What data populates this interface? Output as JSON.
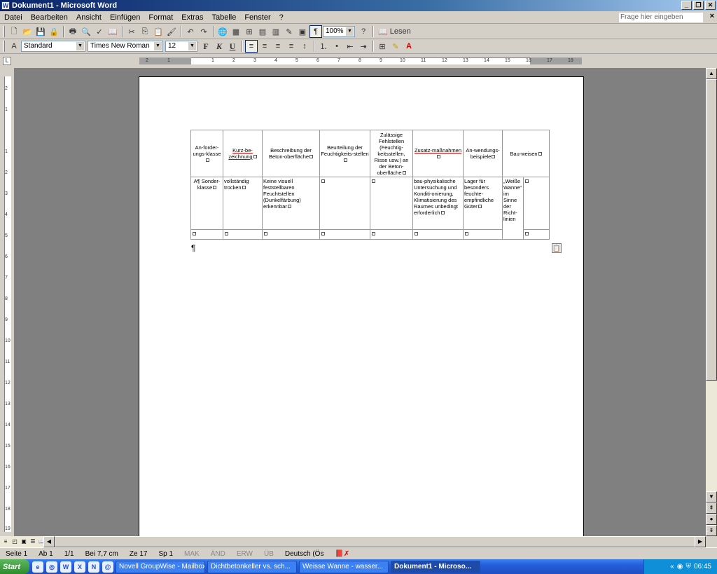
{
  "window": {
    "title": "Dokument1 - Microsoft Word"
  },
  "menu": [
    "Datei",
    "Bearbeiten",
    "Ansicht",
    "Einfügen",
    "Format",
    "Extras",
    "Tabelle",
    "Fenster",
    "?"
  ],
  "help": {
    "placeholder": "Frage hier eingeben"
  },
  "toolbar": {
    "zoom": "100%",
    "read_label": "Lesen",
    "style": "Standard",
    "font": "Times New Roman",
    "size": "12",
    "bold": "F",
    "italic": "K",
    "underline": "U",
    "pilcrow": "¶"
  },
  "ruler": {
    "h_ticks": [
      "2",
      "1",
      "1",
      "2",
      "3",
      "4",
      "5",
      "6",
      "7",
      "8",
      "9",
      "10",
      "11",
      "12",
      "13",
      "14",
      "15",
      "16",
      "17",
      "18"
    ],
    "v_ticks": [
      "2",
      "1",
      "1",
      "2",
      "3",
      "4",
      "5",
      "6",
      "7",
      "8",
      "9",
      "10",
      "11",
      "12",
      "13",
      "14",
      "15",
      "16",
      "17",
      "18",
      "19"
    ]
  },
  "table": {
    "headers": [
      "An-forder-ungs-klasse",
      "Kurz-be-zeichnung",
      "Beschreibung der Beton-oberfläche",
      "Beurteilung der Feuchtigkeits-stellen",
      "Zulässige Fehlstellen (Feuchtig-keitsstellen, Risse usw.) an der Beton-oberfläche",
      "Zusatz-maßnahmen",
      "An-wendungs-beispiele",
      "Bau-weisen"
    ],
    "row1": [
      "A¶ Sonder-klasse",
      "vollständig trocken",
      "Keine visuell feststellbaren Feuchtstellen (Dunkelfärbung) erkennbar",
      "",
      "",
      "bau-physikalische Untersuchung und Konditi-onierung, Klimatisierung des Raumes unbedingt erforderlich",
      "Lager für besonders feuchte-empfindliche Güter",
      "„Weiße Wanne“ im Sinne der Richt-linien",
      ""
    ]
  },
  "paragraph_mark": "¶",
  "status": {
    "page": "Seite 1",
    "section": "Ab 1",
    "pages": "1/1",
    "at": "Bei 7,7 cm",
    "line": "Ze 17",
    "col": "Sp 1",
    "mak": "MAK",
    "aend": "ÄND",
    "erw": "ERW",
    "ub": "ÜB",
    "lang": "Deutsch (Ös"
  },
  "taskbar": {
    "start": "Start",
    "tasks": [
      "Novell GroupWise - Mailbox",
      "Dichtbetonkeller vs. sch...",
      "Weisse Wanne - wasser...",
      "Dokument1 - Microso..."
    ],
    "clock": "06:45"
  }
}
